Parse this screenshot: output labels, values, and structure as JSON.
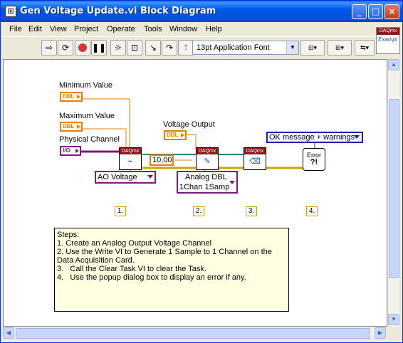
{
  "window": {
    "title": "Gen Voltage Update.vi Block Diagram",
    "icon_glyph": "⊞",
    "buttons": {
      "minimize": "_",
      "maximize": "□",
      "close": "×"
    }
  },
  "menu": [
    "File",
    "Edit",
    "View",
    "Project",
    "Operate",
    "Tools",
    "Window",
    "Help"
  ],
  "toolbar": {
    "font_select": "13pt Application Font",
    "icons": [
      "run-arrow-icon",
      "run-continuous-icon",
      "abort-icon",
      "pause-icon",
      "highlight-execution-icon",
      "retain-wire-values-icon",
      "step-into-icon",
      "step-over-icon",
      "step-out-icon",
      "align-objects-icon",
      "distribute-objects-icon",
      "reorder-icon"
    ]
  },
  "corner_icon": {
    "header": "DAQmx",
    "label": "Exampl"
  },
  "diagram": {
    "labels": {
      "min_value": "Minimum Value",
      "max_value": "Maximum Value",
      "phys_channel": "Physical Channel",
      "voltage_output": "Voltage Output"
    },
    "constants": {
      "dbl_tag": "DBL",
      "io_tag": "I/O",
      "timeout": "10,00"
    },
    "vis": {
      "create_header": "DAQmx",
      "write_header": "DAQmx",
      "clear_header": "DAQmx",
      "create_sym": "⌁",
      "write_sym": "✎",
      "clear_sym": "⌫"
    },
    "rings": {
      "ao_voltage": "AO Voltage",
      "analog_dbl_1": "Analog DBL",
      "analog_dbl_2": "1Chan 1Samp",
      "ok_message": "OK message + warnings"
    },
    "error_vi": {
      "line1": "Error",
      "line2": "?!"
    },
    "steps": [
      "1.",
      "2.",
      "3.",
      "4."
    ],
    "notes": [
      "Steps:",
      "1. Create an Analog Output Voltage Channel",
      "2. Use the Write VI to Generate 1 Sample to 1 Channel on the Data Acquisition Card.",
      "3.   Call the Clear Task VI to clear the Task.",
      "4.   Use the popup dialog box to display an error if any."
    ]
  },
  "colors": {
    "title_blue": "#0058e6",
    "dbl_orange": "#e97d00",
    "io_purple": "#7a1a7a",
    "daqmx_header": "#8b1a1a",
    "notes_bg": "#ffffe1",
    "error_wire_yellow": "#c8a400"
  }
}
